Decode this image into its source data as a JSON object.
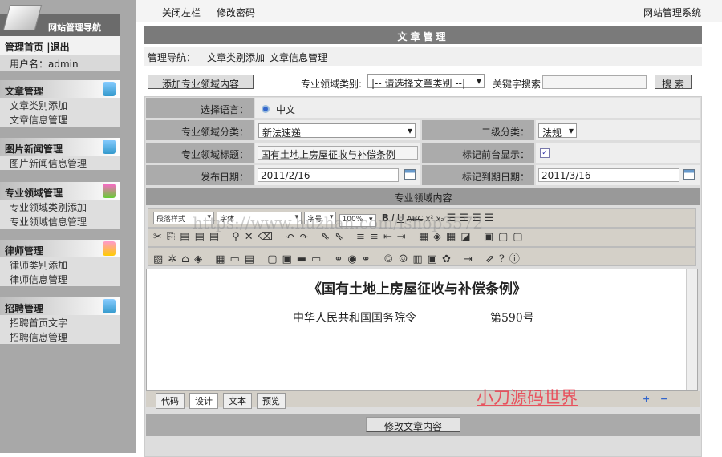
{
  "sidebar": {
    "title": "网站管理导航",
    "home": "管理首页",
    "sep": "|",
    "logout": "退出",
    "user": "用户名：admin",
    "groups": [
      {
        "title": "文章管理",
        "items": [
          "文章类别添加",
          "文章信息管理"
        ]
      },
      {
        "title": "图片新闻管理",
        "items": [
          "图片新闻信息管理"
        ]
      },
      {
        "title": "专业领域管理",
        "items": [
          "专业领域类别添加",
          "专业领域信息管理"
        ]
      },
      {
        "title": "律师管理",
        "items": [
          "律师类别添加",
          "律师信息管理"
        ]
      },
      {
        "title": "招聘管理",
        "items": [
          "招聘首页文字",
          "招聘信息管理"
        ]
      }
    ]
  },
  "topbar": {
    "close_left": "关闭左栏",
    "change_pw": "修改密码",
    "system": "网站管理系统"
  },
  "main": {
    "title": "文章管理",
    "nav_label": "管理导航：",
    "nav_links": [
      "文章类别添加",
      "文章信息管理"
    ],
    "add_button": "添加专业领域内容",
    "category_label": "专业领域类别:",
    "category_select": "|-- 请选择文章类别 --|",
    "keyword_label": "关键字搜索",
    "keyword_value": "",
    "search_button": "搜 索"
  },
  "form": {
    "lang_label": "选择语言：",
    "lang_value": "中文",
    "cat_label": "专业领域分类：",
    "cat_value": "新法速递",
    "sub_label": "二级分类：",
    "sub_value": "法规",
    "title_label": "专业领域标题：",
    "title_value": "国有土地上房屋征收与补偿条例",
    "show_label": "标记前台显示：",
    "show_checked": true,
    "date_label": "发布日期：",
    "date_value": "2011/2/16",
    "expire_label": "标记到期日期：",
    "expire_value": "2011/3/16",
    "content_header": "专业领域内容"
  },
  "editor": {
    "para_style": "段落样式",
    "font": "字体",
    "size": "字号",
    "zoom": "100%",
    "doc_title": "《国有土地上房屋征收与补偿条例》",
    "doc_sub": "中华人民共和国国务院令",
    "doc_no": "第590号",
    "tabs": [
      "代码",
      "设计",
      "文本",
      "预览"
    ]
  },
  "submit_button": "修改文章内容",
  "watermarks": [
    "https://www.huzhan.com/ishop3572",
    "小刀源码世界"
  ]
}
